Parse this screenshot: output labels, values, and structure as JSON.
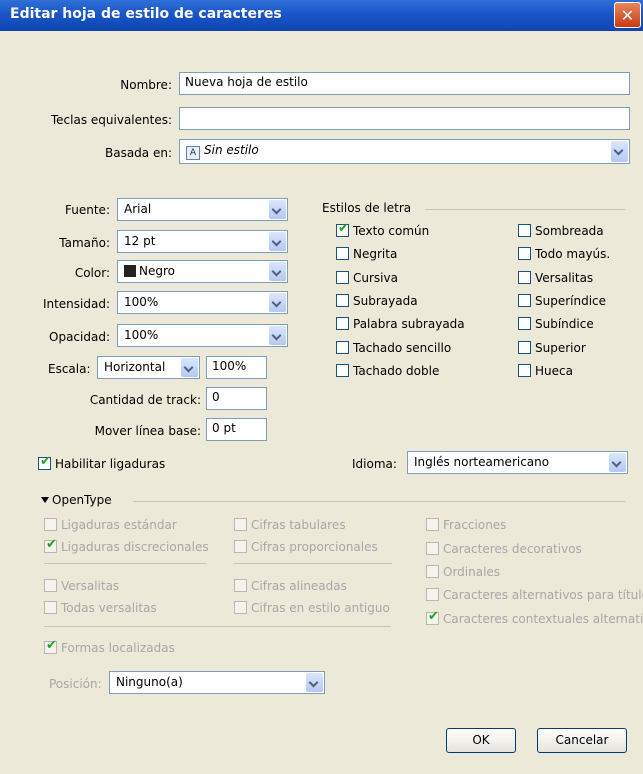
{
  "window": {
    "title": "Editar hoja de estilo de caracteres",
    "close": "✕"
  },
  "general": {
    "name_label": "Nombre:",
    "name_value": "Nueva hoja de estilo",
    "keys_label": "Teclas equivalentes:",
    "keys_value": "",
    "based_label": "Basada en:",
    "based_value": "Sin estilo",
    "based_icon": "A"
  },
  "font": {
    "font_label": "Fuente:",
    "font_value": "Arial",
    "size_label": "Tamaño:",
    "size_value": "12 pt",
    "color_label": "Color:",
    "color_value": "Negro",
    "color_hex": "#222222",
    "intensity_label": "Intensidad:",
    "intensity_value": "100%",
    "opacity_label": "Opacidad:",
    "opacity_value": "100%",
    "scale_label": "Escala:",
    "scale_value": "Horizontal",
    "scale_pct": "100%",
    "track_label": "Cantidad de track:",
    "track_value": "0",
    "baseline_label": "Mover línea base:",
    "baseline_value": "0 pt"
  },
  "styles": {
    "heading": "Estilos de letra",
    "left": [
      {
        "label": "Texto común",
        "checked": true
      },
      {
        "label": "Negrita",
        "checked": false
      },
      {
        "label": "Cursiva",
        "checked": false
      },
      {
        "label": "Subrayada",
        "checked": false
      },
      {
        "label": "Palabra subrayada",
        "checked": false
      },
      {
        "label": "Tachado sencillo",
        "checked": false
      },
      {
        "label": "Tachado doble",
        "checked": false
      }
    ],
    "right": [
      {
        "label": "Sombreada",
        "checked": false
      },
      {
        "label": "Todo mayús.",
        "checked": false
      },
      {
        "label": "Versalitas",
        "checked": false
      },
      {
        "label": "Superíndice",
        "checked": false
      },
      {
        "label": "Subíndice",
        "checked": false
      },
      {
        "label": "Superior",
        "checked": false
      },
      {
        "label": "Hueca",
        "checked": false
      }
    ]
  },
  "ligatures": {
    "label": "Habilitar ligaduras",
    "checked": true
  },
  "language": {
    "label": "Idioma:",
    "value": "Inglés norteamericano"
  },
  "opentype": {
    "heading": "OpenType",
    "col1": [
      {
        "label": "Ligaduras estándar",
        "checked": false
      },
      {
        "label": "Ligaduras discrecionales",
        "checked": true
      },
      {
        "label": "Versalitas",
        "checked": false
      },
      {
        "label": "Todas versalitas",
        "checked": false
      }
    ],
    "col2": [
      {
        "label": "Cifras tabulares",
        "checked": false
      },
      {
        "label": "Cifras proporcionales",
        "checked": false
      },
      {
        "label": "Cifras alineadas",
        "checked": false
      },
      {
        "label": "Cifras en estilo antiguo",
        "checked": false
      }
    ],
    "col3": [
      {
        "label": "Fracciones",
        "checked": false
      },
      {
        "label": "Caracteres decorativos",
        "checked": false
      },
      {
        "label": "Ordinales",
        "checked": false
      },
      {
        "label": "Caracteres alternativos para títulos",
        "checked": false
      },
      {
        "label": "Caracteres contextuales alternativos",
        "checked": true
      }
    ],
    "localized": {
      "label": "Formas localizadas",
      "checked": true
    },
    "position_label": "Posición:",
    "position_value": "Ninguno(a)"
  },
  "buttons": {
    "ok": "OK",
    "cancel": "Cancelar"
  }
}
